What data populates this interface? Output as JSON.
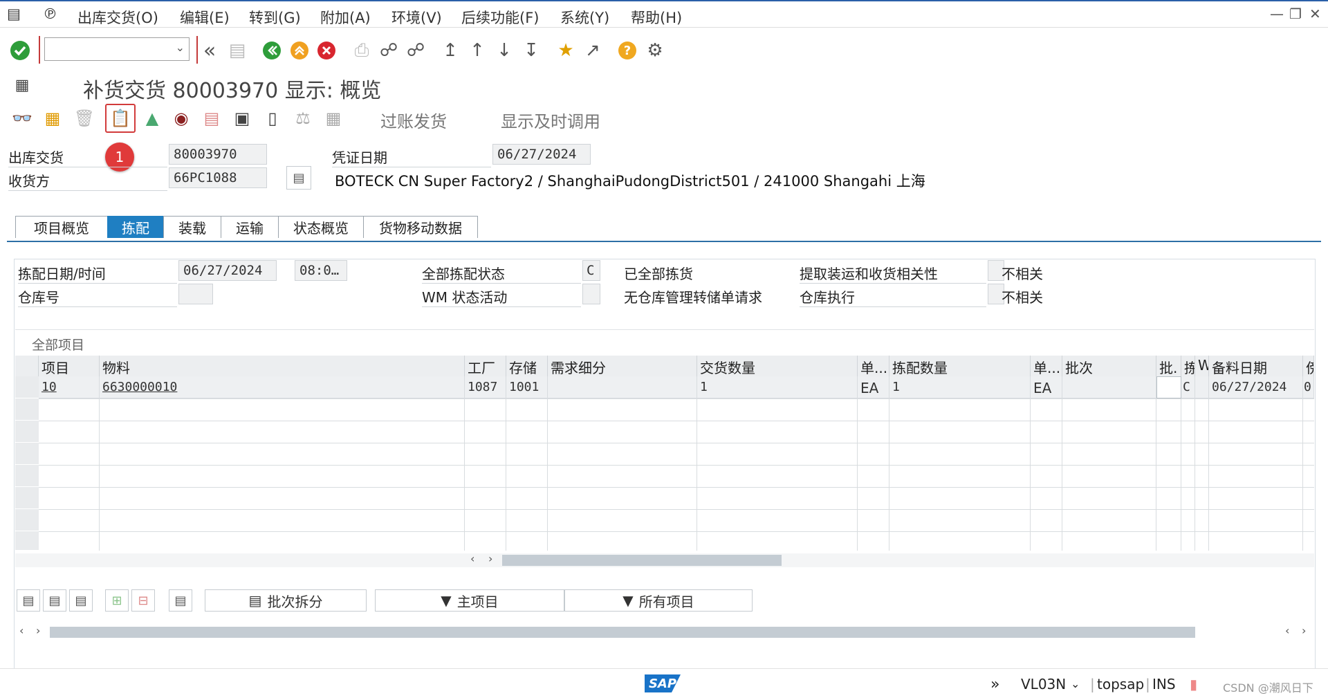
{
  "menu": {
    "items": [
      "出库交货(O)",
      "编辑(E)",
      "转到(G)",
      "附加(A)",
      "环境(V)",
      "后续功能(F)",
      "系统(Y)",
      "帮助(H)"
    ]
  },
  "toolbar": {
    "command_value": ""
  },
  "title": "补货交货 80003970 显示: 概览",
  "app_toolbar": {
    "post_goods_issue": "过账发货",
    "show_timely_call": "显示及时调用",
    "badge": "1"
  },
  "header": {
    "outbound_delivery_label": "出库交货",
    "outbound_delivery_value": "80003970",
    "ship_to_label": "收货方",
    "ship_to_value": "66PC1088",
    "doc_date_label": "凭证日期",
    "doc_date_value": "06/27/2024",
    "ship_to_address": "BOTECK CN Super Factory2 / ShanghaiPudongDistrict501 / 241000 Shangahi 上海"
  },
  "tabs": [
    "项目概览",
    "拣配",
    "装载",
    "运输",
    "状态概览",
    "货物移动数据"
  ],
  "picking": {
    "pick_date_label": "拣配日期/时间",
    "pick_date_value": "06/27/2024",
    "pick_time_value": "08:0…",
    "warehouse_label": "仓库号",
    "warehouse_value": "",
    "overall_pick_status_label": "全部拣配状态",
    "overall_pick_status_value": "C",
    "wm_status_label": "WM 状态活动",
    "wm_status_value": "",
    "fully_picked_label": "已全部拣货",
    "no_wm_label": "无仓库管理转储单请求",
    "pick_relevance_label": "提取装运和收货相关性",
    "pick_relevance_value": "不相关",
    "wh_exec_label": "仓库执行",
    "wh_exec_value": "不相关"
  },
  "items_section": "全部项目",
  "table": {
    "columns": [
      "项目",
      "物料",
      "工厂",
      "存储",
      "需求细分",
      "交货数量",
      "单...",
      "拣配数量",
      "单...",
      "批次",
      "批.",
      "拣",
      "W",
      "备料日期",
      "傍"
    ],
    "rows": [
      [
        "10",
        "6630000010",
        "1087",
        "1001",
        "",
        "1",
        "EA",
        "1",
        "EA",
        "",
        "",
        "C",
        "",
        "06/27/2024",
        "0"
      ]
    ]
  },
  "bottom_buttons": {
    "batch_split": "批次拆分",
    "main_items": "主项目",
    "all_items": "所有项目"
  },
  "status": {
    "logo": "SAP",
    "transaction": "VL03N",
    "system": "topsap",
    "mode": "INS",
    "watermark": "CSDN @潮风日下"
  }
}
